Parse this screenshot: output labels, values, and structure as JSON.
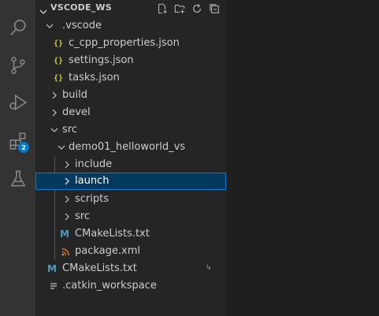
{
  "activity_bar": {
    "badge_count": "2",
    "icons": [
      "explorer-icon",
      "search-icon",
      "source-control-icon",
      "run-debug-icon",
      "extensions-icon",
      "testing-icon"
    ]
  },
  "explorer": {
    "title": "VSCODE_WS",
    "actions": [
      "new-file-icon",
      "new-folder-icon",
      "refresh-icon",
      "collapse-all-icon"
    ],
    "tree": [
      {
        "label": ".vscode",
        "type": "folder",
        "expanded": true
      },
      {
        "label": "c_cpp_properties.json",
        "type": "json"
      },
      {
        "label": "settings.json",
        "type": "json"
      },
      {
        "label": "tasks.json",
        "type": "json"
      },
      {
        "label": "build",
        "type": "folder",
        "expanded": false
      },
      {
        "label": "devel",
        "type": "folder",
        "expanded": false
      },
      {
        "label": "src",
        "type": "folder",
        "expanded": true
      },
      {
        "label": "demo01_helloworld_vs",
        "type": "folder",
        "expanded": true
      },
      {
        "label": "include",
        "type": "folder",
        "expanded": false
      },
      {
        "label": "launch",
        "type": "folder",
        "expanded": false,
        "selected": true
      },
      {
        "label": "scripts",
        "type": "folder",
        "expanded": false
      },
      {
        "label": "src",
        "type": "folder",
        "expanded": false
      },
      {
        "label": "CMakeLists.txt",
        "type": "cmake"
      },
      {
        "label": "package.xml",
        "type": "xml"
      },
      {
        "label": "CMakeLists.txt",
        "type": "cmake"
      },
      {
        "label": ".catkin_workspace",
        "type": "text"
      }
    ]
  },
  "colors": {
    "activity_bar": "#333333",
    "sidebar": "#252526",
    "editor": "#1e1e1e",
    "selection": "#04395e",
    "focus_border": "#007fd4",
    "badge": "#007acc",
    "json_icon": "#cbcb41",
    "xml_icon": "#e37933"
  }
}
